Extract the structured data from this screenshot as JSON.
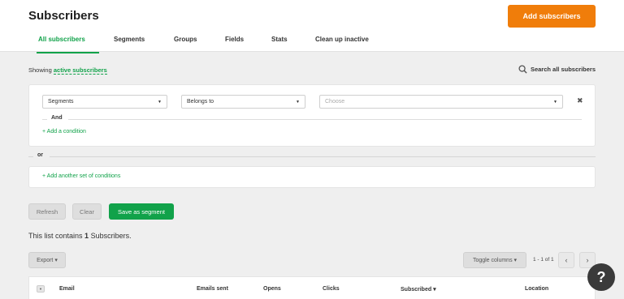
{
  "header": {
    "title": "Subscribers",
    "add_button": "Add subscribers",
    "tabs": [
      "All subscribers",
      "Segments",
      "Groups",
      "Fields",
      "Stats",
      "Clean up inactive"
    ]
  },
  "filter": {
    "showing_prefix": "Showing",
    "showing_link": "active subscribers",
    "search_label": "Search all subscribers",
    "condition_field": "Segments",
    "condition_operator": "Belongs to",
    "condition_value_placeholder": "Choose",
    "and_label": "And",
    "add_condition": "+ Add a condition",
    "or_label": "or",
    "add_set": "+ Add another set of conditions"
  },
  "actions": {
    "refresh": "Refresh",
    "clear": "Clear",
    "save_segment": "Save as segment"
  },
  "summary": {
    "prefix": "This list contains",
    "count": "1",
    "suffix": "Subscribers."
  },
  "table": {
    "export": "Export ▾",
    "toggle_columns": "Toggle columns ▾",
    "pager": "1 - 1 of 1",
    "columns": [
      "Email",
      "Emails sent",
      "Opens",
      "Clicks",
      "Subscribed ▾",
      "Location"
    ]
  },
  "help": "?",
  "colors": {
    "accent": "#11a24a",
    "brand_orange": "#f07d0a"
  }
}
